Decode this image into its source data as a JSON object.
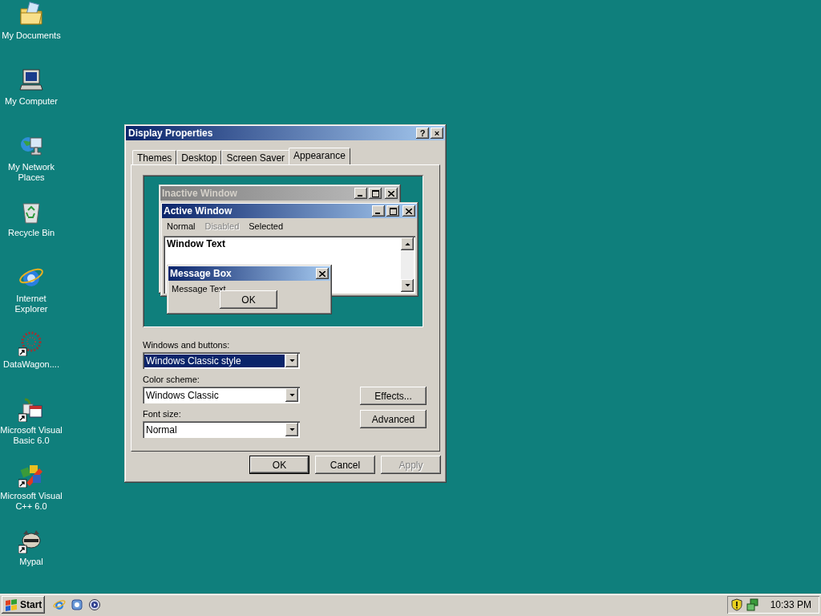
{
  "desktop_icons": [
    {
      "label": "My Documents",
      "kind": "documents",
      "shortcut": false
    },
    {
      "label": "My Computer",
      "kind": "computer",
      "shortcut": false
    },
    {
      "label": "My Network Places",
      "kind": "network",
      "shortcut": false
    },
    {
      "label": "Recycle Bin",
      "kind": "recycle",
      "shortcut": false
    },
    {
      "label": "Internet Explorer",
      "kind": "ie",
      "shortcut": false
    },
    {
      "label": "DataWagon....",
      "kind": "datawagon",
      "shortcut": true
    },
    {
      "label": "Microsoft Visual Basic 6.0",
      "kind": "vb",
      "shortcut": true
    },
    {
      "label": "Microsoft Visual C++ 6.0",
      "kind": "vc",
      "shortcut": true
    },
    {
      "label": "Mypal",
      "kind": "mypal",
      "shortcut": true
    }
  ],
  "dialog": {
    "title": "Display Properties",
    "help_button": "?",
    "close_button": "×",
    "tabs": [
      {
        "label": "Themes",
        "selected": false
      },
      {
        "label": "Desktop",
        "selected": false
      },
      {
        "label": "Screen Saver",
        "selected": false
      },
      {
        "label": "Appearance",
        "selected": true
      }
    ],
    "preview": {
      "inactive_title": "Inactive Window",
      "active_title": "Active Window",
      "menu": [
        {
          "label": "Normal",
          "disabled": false
        },
        {
          "label": "Disabled",
          "disabled": true
        },
        {
          "label": "Selected",
          "disabled": false
        }
      ],
      "window_text": "Window Text",
      "message_box": {
        "title": "Message Box",
        "text": "Message Text",
        "button": "OK"
      }
    },
    "fields": [
      {
        "label": "Windows and buttons:",
        "value": "Windows Classic style",
        "focused": true
      },
      {
        "label": "Color scheme:",
        "value": "Windows Classic",
        "focused": false
      },
      {
        "label": "Font size:",
        "value": "Normal",
        "focused": false
      }
    ],
    "side_buttons": [
      "Effects...",
      "Advanced"
    ],
    "buttons": [
      {
        "label": "OK",
        "default": true,
        "disabled": false
      },
      {
        "label": "Cancel",
        "default": false,
        "disabled": false
      },
      {
        "label": "Apply",
        "default": false,
        "disabled": true
      }
    ]
  },
  "taskbar": {
    "start": "Start",
    "quick_launch": [
      {
        "kind": "ie"
      },
      {
        "kind": "outlook"
      },
      {
        "kind": "media"
      }
    ],
    "time": "10:33 PM"
  }
}
